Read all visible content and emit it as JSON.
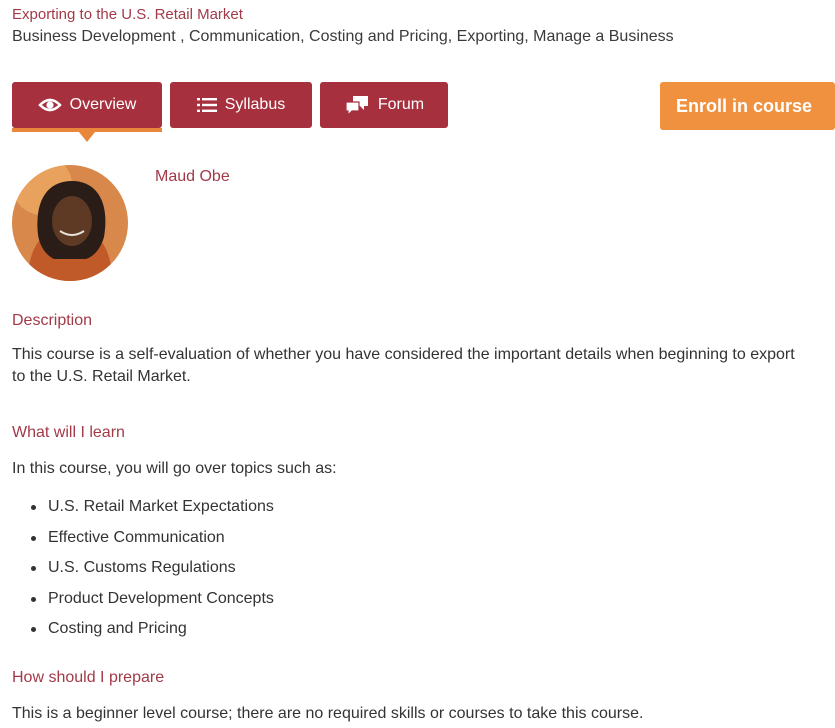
{
  "course": {
    "title": "Exporting to the U.S. Retail Market",
    "categories": "Business Development , Communication, Costing and Pricing, Exporting, Manage a Business"
  },
  "tabs": [
    {
      "label": "Overview",
      "icon": "eye-icon",
      "active": true
    },
    {
      "label": "Syllabus",
      "icon": "list-icon",
      "active": false
    },
    {
      "label": "Forum",
      "icon": "chat-bubbles-icon",
      "active": false
    }
  ],
  "enroll": {
    "label": "Enroll in course"
  },
  "instructor": {
    "name": "Maud Obe"
  },
  "description": {
    "heading": "Description",
    "text": "This course is a self-evaluation of whether you have considered the important details when beginning to export to the U.S. Retail Market."
  },
  "learn": {
    "heading": "What will I learn",
    "intro": "In this course, you will go over topics such as:",
    "items": [
      "U.S. Retail Market Expectations",
      "Effective Communication",
      "U.S. Customs Regulations",
      "Product Development Concepts",
      "Costing and Pricing"
    ]
  },
  "prepare": {
    "heading": "How should I prepare",
    "text": "This is a beginner level course; there are no required skills or courses to take this course."
  },
  "colors": {
    "brand": "#a6303e",
    "accent": "#f0913f",
    "heading": "#a23a48"
  }
}
